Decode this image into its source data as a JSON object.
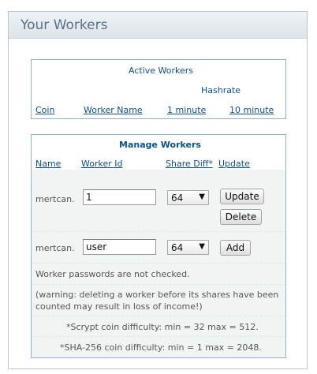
{
  "panel": {
    "title": "Your Workers"
  },
  "active_workers": {
    "title": "Active Workers",
    "group_label": "Hashrate",
    "columns": [
      "Coin",
      "Worker Name",
      "1 minute",
      "10 minute"
    ]
  },
  "manage_workers": {
    "title": "Manage Workers",
    "columns": [
      "Name",
      "Worker Id",
      "Share Diff*",
      "Update"
    ],
    "rows": [
      {
        "name": "mertcan.",
        "worker_id": "1",
        "share_diff": "64",
        "buttons": [
          "Update",
          "Delete"
        ]
      },
      {
        "name": "mertcan.",
        "worker_id": "user",
        "share_diff": "64",
        "buttons": [
          "Add"
        ]
      }
    ],
    "notes": [
      "Worker passwords are not checked.",
      "(warning: deleting a worker before its shares have been",
      "counted may result in loss of income!)",
      "*Scrypt coin difficulty: min = 32 max = 512.",
      "*SHA-256 coin difficulty: min = 1 max = 2048."
    ]
  }
}
